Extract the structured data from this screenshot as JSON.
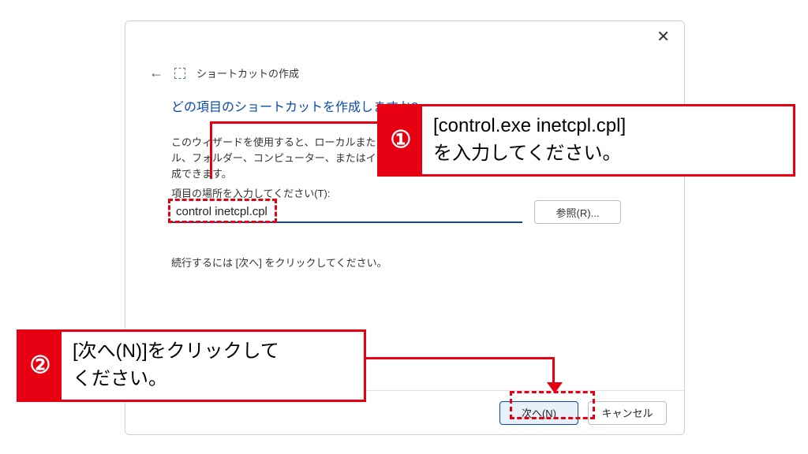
{
  "dialog": {
    "close": "✕",
    "back": "←",
    "title": "ショートカットの作成",
    "heading": "どの項目のショートカットを作成しますか?",
    "description": "このウィザードを使用すると、ローカルまたはネットワーク上にあるプログラム、ファイル、フォルダー、コンピューター、またはインターネット アドレスへのショートカットを作成できます。",
    "location_label": "項目の場所を入力してください(T):",
    "location_value": "control inetcpl.cpl",
    "browse": "参照(R)...",
    "continue": "続行するには [次へ] をクリックしてください。",
    "next": "次へ(N)",
    "cancel": "キャンセル"
  },
  "callouts": {
    "one": {
      "num": "①",
      "text": "[control.exe inetcpl.cpl]\nを入力してください。"
    },
    "two": {
      "num": "②",
      "text": "[次へ(N)]をクリックして\nください。"
    }
  }
}
